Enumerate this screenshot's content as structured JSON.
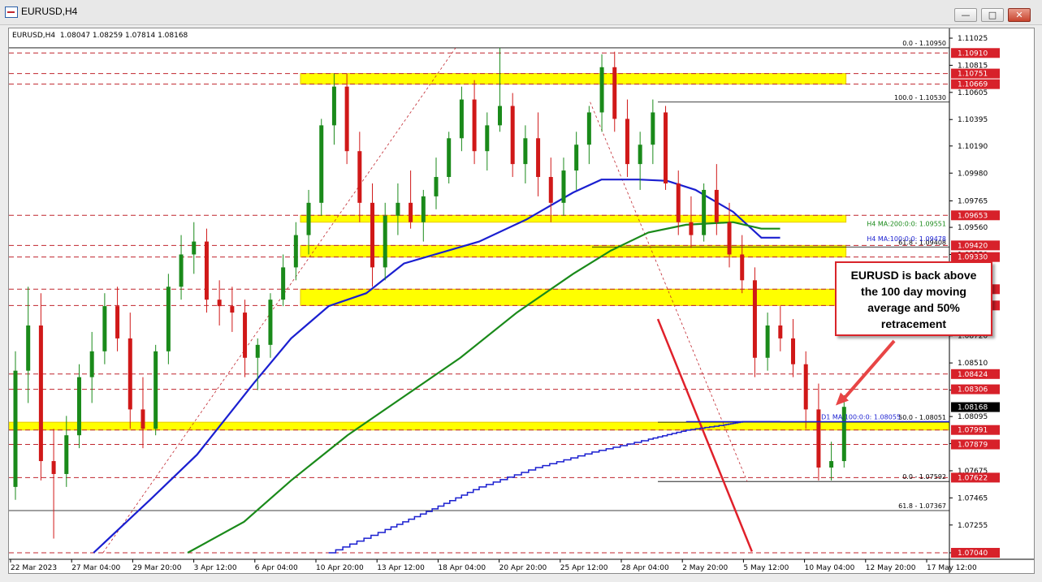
{
  "window": {
    "title": "EURUSD,H4",
    "minimize": "—",
    "maximize": "□",
    "close": "✕",
    "icon": "chart-window-icon"
  },
  "chart_data": {
    "type": "candlestick",
    "symbol": "EURUSD",
    "timeframe": "H4",
    "ohlc_header": "EURUSD,H4  1.08047 1.08259 1.07814 1.08168",
    "ylim": [
      1.0704,
      1.11025
    ],
    "price_ticks": [
      "1.11025",
      "1.10815",
      "1.10605",
      "1.10395",
      "1.10190",
      "1.09980",
      "1.09765",
      "1.09560",
      "1.09350",
      "1.09140",
      "1.08930",
      "1.08720",
      "1.08510",
      "1.08300",
      "1.08095",
      "1.07885",
      "1.07675",
      "1.07465",
      "1.07255",
      "1.07040"
    ],
    "time_ticks": [
      "22 Mar 2023",
      "27 Mar 04:00",
      "29 Mar 20:00",
      "3 Apr 12:00",
      "6 Apr 04:00",
      "10 Apr 20:00",
      "13 Apr 12:00",
      "18 Apr 04:00",
      "20 Apr 20:00",
      "25 Apr 12:00",
      "28 Apr 04:00",
      "2 May 20:00",
      "5 May 12:00",
      "10 May 04:00",
      "12 May 20:00",
      "17 May 12:00"
    ],
    "current_price": "1.08168",
    "red_levels": [
      "1.10910",
      "1.10751",
      "1.10669",
      "1.09653",
      "1.09420",
      "1.09330",
      "1.09081",
      "1.08955",
      "1.08424",
      "1.08306",
      "1.07991",
      "1.07879",
      "1.07622",
      "1.07040"
    ],
    "level_values": [
      1.1091,
      1.10751,
      1.10669,
      1.09653,
      1.0942,
      1.0933,
      1.09081,
      1.08955,
      1.08424,
      1.08306,
      1.07991,
      1.07879,
      1.07622,
      1.0704
    ],
    "yellow_zones": [
      [
        1.10669,
        1.10751
      ],
      [
        1.096,
        1.09653
      ],
      [
        1.0933,
        1.0942
      ],
      [
        1.08955,
        1.09081
      ],
      [
        1.07991,
        1.08051
      ]
    ],
    "fib_labels": {
      "top_0": "0.0 - 1.10950",
      "f100": "100.0 - 1.10530",
      "f618_up": "61.8 - 1.09408",
      "f50": "50.0 - 1.08051",
      "f0": "0.0 - 1.07592",
      "f618_down": "61.8 - 1.07367"
    },
    "fib_values": {
      "top_0": 1.1095,
      "f100": 1.1053,
      "f618_up": 1.09408,
      "f50": 1.08051,
      "f0": 1.07592,
      "f618_down": 1.07367
    },
    "ma_labels": {
      "ma200": "H4 MA:200:0:0: 1.09551",
      "ma100": "H4 MA:100:0:0: 1.09478",
      "d1": "D1 MA:100:0:0: 1.08055"
    },
    "ma_values": {
      "ma200": 1.09551,
      "ma100": 1.09478,
      "d1": 1.08055
    },
    "series": [
      {
        "color": "#1a1fd0",
        "points": [
          [
            0.09,
            1.0704
          ],
          [
            0.15,
            1.0745
          ],
          [
            0.2,
            1.078
          ],
          [
            0.26,
            1.0835
          ],
          [
            0.3,
            1.087
          ],
          [
            0.34,
            1.0895
          ],
          [
            0.38,
            1.0905
          ],
          [
            0.42,
            1.0928
          ],
          [
            0.5,
            1.0945
          ],
          [
            0.55,
            1.0962
          ],
          [
            0.6,
            1.0983
          ],
          [
            0.63,
            1.0993
          ],
          [
            0.67,
            1.0993
          ],
          [
            0.7,
            1.0992
          ],
          [
            0.73,
            1.0985
          ],
          [
            0.77,
            1.0968
          ],
          [
            0.8,
            1.0948
          ],
          [
            0.82,
            1.0948
          ]
        ]
      },
      {
        "color": "#1a8a1a",
        "points": [
          [
            0.19,
            1.0704
          ],
          [
            0.25,
            1.0728
          ],
          [
            0.3,
            1.076
          ],
          [
            0.36,
            1.0795
          ],
          [
            0.42,
            1.0825
          ],
          [
            0.48,
            1.0855
          ],
          [
            0.54,
            1.089
          ],
          [
            0.6,
            1.092
          ],
          [
            0.64,
            1.0938
          ],
          [
            0.68,
            1.0952
          ],
          [
            0.72,
            1.0958
          ],
          [
            0.77,
            1.096
          ],
          [
            0.8,
            1.0955
          ],
          [
            0.82,
            1.0955
          ]
        ]
      },
      {
        "color": "#1a1fd0",
        "step": true,
        "points": [
          [
            0.34,
            1.0704
          ],
          [
            0.4,
            1.0722
          ],
          [
            0.45,
            1.0738
          ],
          [
            0.5,
            1.0755
          ],
          [
            0.56,
            1.077
          ],
          [
            0.62,
            1.0782
          ],
          [
            0.68,
            1.0792
          ],
          [
            0.72,
            1.0799
          ],
          [
            0.76,
            1.0803
          ],
          [
            0.78,
            1.08055
          ],
          [
            0.82,
            1.08055
          ]
        ]
      }
    ],
    "candles": [
      [
        1.0755,
        1.086,
        1.0745,
        1.0845
      ],
      [
        1.0845,
        1.091,
        1.082,
        1.088
      ],
      [
        1.088,
        1.0905,
        1.076,
        1.0775
      ],
      [
        1.0775,
        1.08,
        1.0715,
        1.0765
      ],
      [
        1.0765,
        1.081,
        1.0755,
        1.0795
      ],
      [
        1.0795,
        1.085,
        1.0785,
        1.084
      ],
      [
        1.084,
        1.0875,
        1.082,
        1.086
      ],
      [
        1.086,
        1.0905,
        1.085,
        1.0895
      ],
      [
        1.0895,
        1.091,
        1.086,
        1.087
      ],
      [
        1.087,
        1.089,
        1.08,
        1.0815
      ],
      [
        1.0815,
        1.084,
        1.0785,
        1.08
      ],
      [
        1.08,
        1.0865,
        1.0795,
        1.086
      ],
      [
        1.086,
        1.092,
        1.085,
        1.091
      ],
      [
        1.091,
        1.095,
        1.09,
        1.0935
      ],
      [
        1.0935,
        1.096,
        1.092,
        1.0945
      ],
      [
        1.0945,
        1.0955,
        1.089,
        1.09
      ],
      [
        1.09,
        1.0915,
        1.088,
        1.0895
      ],
      [
        1.0895,
        1.091,
        1.0875,
        1.089
      ],
      [
        1.089,
        1.09,
        1.084,
        1.0855
      ],
      [
        1.0855,
        1.087,
        1.083,
        1.0865
      ],
      [
        1.0865,
        1.0905,
        1.0855,
        1.09
      ],
      [
        1.09,
        1.0935,
        1.0895,
        1.0925
      ],
      [
        1.0925,
        1.096,
        1.0915,
        1.095
      ],
      [
        1.095,
        1.0985,
        1.0935,
        1.0975
      ],
      [
        1.0975,
        1.104,
        1.0965,
        1.1035
      ],
      [
        1.1035,
        1.1075,
        1.102,
        1.1065
      ],
      [
        1.1065,
        1.1075,
        1.1005,
        1.1015
      ],
      [
        1.1015,
        1.103,
        1.096,
        1.0975
      ],
      [
        1.0975,
        1.099,
        1.091,
        1.0925
      ],
      [
        1.0925,
        1.0975,
        1.0915,
        1.0965
      ],
      [
        1.0965,
        1.099,
        1.095,
        1.0975
      ],
      [
        1.0975,
        1.1,
        1.0955,
        1.096
      ],
      [
        1.096,
        1.0985,
        1.0945,
        1.098
      ],
      [
        1.098,
        1.101,
        1.097,
        1.0995
      ],
      [
        1.0995,
        1.103,
        1.099,
        1.1025
      ],
      [
        1.1025,
        1.1065,
        1.1015,
        1.1055
      ],
      [
        1.1055,
        1.107,
        1.1005,
        1.1015
      ],
      [
        1.1015,
        1.1045,
        1.1,
        1.1035
      ],
      [
        1.1035,
        1.1095,
        1.103,
        1.105
      ],
      [
        1.105,
        1.106,
        1.0995,
        1.1005
      ],
      [
        1.1005,
        1.1035,
        1.099,
        1.1025
      ],
      [
        1.1025,
        1.1045,
        1.098,
        1.0995
      ],
      [
        1.0995,
        1.101,
        1.096,
        1.0975
      ],
      [
        1.0975,
        1.101,
        1.0965,
        1.1
      ],
      [
        1.1,
        1.103,
        1.0985,
        1.102
      ],
      [
        1.102,
        1.105,
        1.1005,
        1.1045
      ],
      [
        1.1045,
        1.109,
        1.103,
        1.108
      ],
      [
        1.108,
        1.1092,
        1.103,
        1.104
      ],
      [
        1.104,
        1.1055,
        1.0995,
        1.1005
      ],
      [
        1.1005,
        1.103,
        1.0985,
        1.102
      ],
      [
        1.102,
        1.1055,
        1.1005,
        1.1045
      ],
      [
        1.1045,
        1.105,
        1.0985,
        1.099
      ],
      [
        1.099,
        1.1,
        1.095,
        1.096
      ],
      [
        1.096,
        1.098,
        1.094,
        1.095
      ],
      [
        1.095,
        1.099,
        1.0945,
        1.0985
      ],
      [
        1.0985,
        1.1005,
        1.095,
        1.096
      ],
      [
        1.096,
        1.0975,
        1.0925,
        1.0935
      ],
      [
        1.0935,
        1.095,
        1.0905,
        1.0915
      ],
      [
        1.0915,
        1.0925,
        1.084,
        1.0855
      ],
      [
        1.0855,
        1.089,
        1.0845,
        1.088
      ],
      [
        1.088,
        1.0895,
        1.086,
        1.087
      ],
      [
        1.087,
        1.0885,
        1.084,
        1.085
      ],
      [
        1.085,
        1.086,
        1.08,
        1.0815
      ],
      [
        1.0815,
        1.0835,
        1.076,
        1.077
      ],
      [
        1.077,
        1.079,
        1.076,
        1.0775
      ],
      [
        1.0775,
        1.0826,
        1.077,
        1.0817
      ]
    ],
    "trendline": [
      [
        0.69,
        1.0885
      ],
      [
        0.79,
        1.0705
      ]
    ],
    "fib_lines": [
      [
        0.1,
        1.0704,
        0.475,
        1.1095
      ],
      [
        0.618,
        1.1053,
        0.785,
        1.07592
      ]
    ]
  },
  "annotation": {
    "lines": [
      "EURUSD is back above",
      "the 100 day moving",
      "average and 50%",
      "retracement"
    ]
  }
}
